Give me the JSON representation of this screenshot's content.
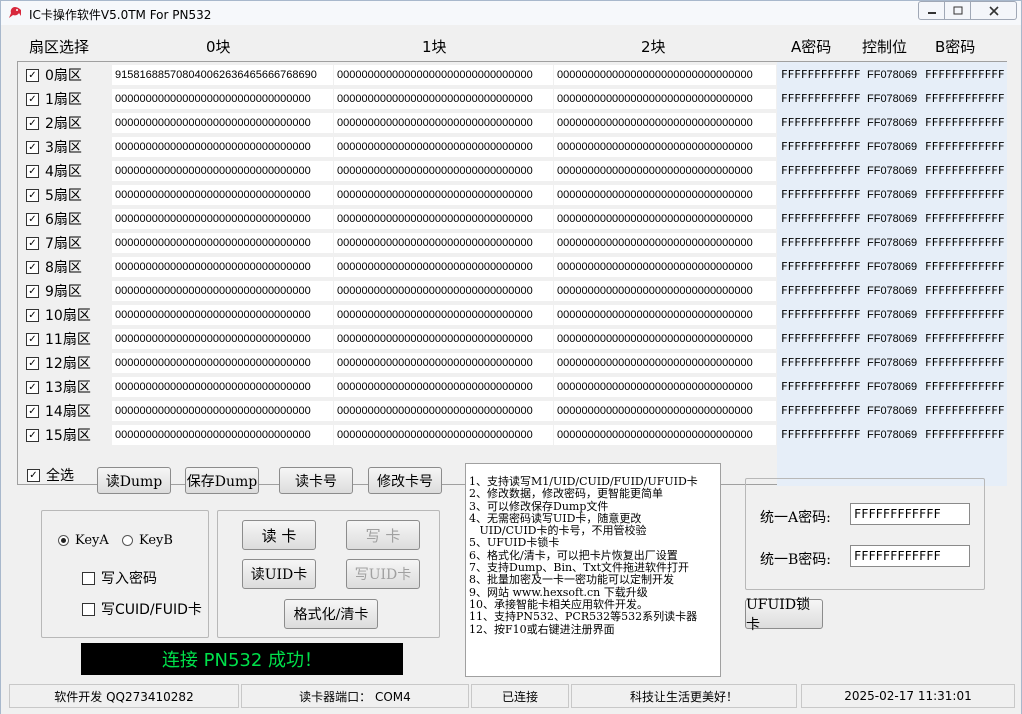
{
  "title": "IC卡操作软件V5.0TM For PN532",
  "columns": {
    "sector": "扇区选择",
    "block0": "0块",
    "block1": "1块",
    "block2": "2块",
    "keyA": "A密码",
    "control": "控制位",
    "keyB": "B密码"
  },
  "sectors": [
    {
      "label": "0扇区",
      "checked": true,
      "b0": "915816885708040062636465666768690",
      "b1": "00000000000000000000000000000000",
      "b2": "00000000000000000000000000000000",
      "keyA": "FFFFFFFFFFFF",
      "ctrl": "FF078069",
      "keyB": "FFFFFFFFFFFF"
    },
    {
      "label": "1扇区",
      "checked": true,
      "b0": "00000000000000000000000000000000",
      "b1": "00000000000000000000000000000000",
      "b2": "00000000000000000000000000000000",
      "keyA": "FFFFFFFFFFFF",
      "ctrl": "FF078069",
      "keyB": "FFFFFFFFFFFF"
    },
    {
      "label": "2扇区",
      "checked": true,
      "b0": "00000000000000000000000000000000",
      "b1": "00000000000000000000000000000000",
      "b2": "00000000000000000000000000000000",
      "keyA": "FFFFFFFFFFFF",
      "ctrl": "FF078069",
      "keyB": "FFFFFFFFFFFF"
    },
    {
      "label": "3扇区",
      "checked": true,
      "b0": "00000000000000000000000000000000",
      "b1": "00000000000000000000000000000000",
      "b2": "00000000000000000000000000000000",
      "keyA": "FFFFFFFFFFFF",
      "ctrl": "FF078069",
      "keyB": "FFFFFFFFFFFF"
    },
    {
      "label": "4扇区",
      "checked": true,
      "b0": "00000000000000000000000000000000",
      "b1": "00000000000000000000000000000000",
      "b2": "00000000000000000000000000000000",
      "keyA": "FFFFFFFFFFFF",
      "ctrl": "FF078069",
      "keyB": "FFFFFFFFFFFF"
    },
    {
      "label": "5扇区",
      "checked": true,
      "b0": "00000000000000000000000000000000",
      "b1": "00000000000000000000000000000000",
      "b2": "00000000000000000000000000000000",
      "keyA": "FFFFFFFFFFFF",
      "ctrl": "FF078069",
      "keyB": "FFFFFFFFFFFF"
    },
    {
      "label": "6扇区",
      "checked": true,
      "b0": "00000000000000000000000000000000",
      "b1": "00000000000000000000000000000000",
      "b2": "00000000000000000000000000000000",
      "keyA": "FFFFFFFFFFFF",
      "ctrl": "FF078069",
      "keyB": "FFFFFFFFFFFF"
    },
    {
      "label": "7扇区",
      "checked": true,
      "b0": "00000000000000000000000000000000",
      "b1": "00000000000000000000000000000000",
      "b2": "00000000000000000000000000000000",
      "keyA": "FFFFFFFFFFFF",
      "ctrl": "FF078069",
      "keyB": "FFFFFFFFFFFF"
    },
    {
      "label": "8扇区",
      "checked": true,
      "b0": "00000000000000000000000000000000",
      "b1": "00000000000000000000000000000000",
      "b2": "00000000000000000000000000000000",
      "keyA": "FFFFFFFFFFFF",
      "ctrl": "FF078069",
      "keyB": "FFFFFFFFFFFF"
    },
    {
      "label": "9扇区",
      "checked": true,
      "b0": "00000000000000000000000000000000",
      "b1": "00000000000000000000000000000000",
      "b2": "00000000000000000000000000000000",
      "keyA": "FFFFFFFFFFFF",
      "ctrl": "FF078069",
      "keyB": "FFFFFFFFFFFF"
    },
    {
      "label": "10扇区",
      "checked": true,
      "b0": "00000000000000000000000000000000",
      "b1": "00000000000000000000000000000000",
      "b2": "00000000000000000000000000000000",
      "keyA": "FFFFFFFFFFFF",
      "ctrl": "FF078069",
      "keyB": "FFFFFFFFFFFF"
    },
    {
      "label": "11扇区",
      "checked": true,
      "b0": "00000000000000000000000000000000",
      "b1": "00000000000000000000000000000000",
      "b2": "00000000000000000000000000000000",
      "keyA": "FFFFFFFFFFFF",
      "ctrl": "FF078069",
      "keyB": "FFFFFFFFFFFF"
    },
    {
      "label": "12扇区",
      "checked": true,
      "b0": "00000000000000000000000000000000",
      "b1": "00000000000000000000000000000000",
      "b2": "00000000000000000000000000000000",
      "keyA": "FFFFFFFFFFFF",
      "ctrl": "FF078069",
      "keyB": "FFFFFFFFFFFF"
    },
    {
      "label": "13扇区",
      "checked": true,
      "b0": "00000000000000000000000000000000",
      "b1": "00000000000000000000000000000000",
      "b2": "00000000000000000000000000000000",
      "keyA": "FFFFFFFFFFFF",
      "ctrl": "FF078069",
      "keyB": "FFFFFFFFFFFF"
    },
    {
      "label": "14扇区",
      "checked": true,
      "b0": "00000000000000000000000000000000",
      "b1": "00000000000000000000000000000000",
      "b2": "00000000000000000000000000000000",
      "keyA": "FFFFFFFFFFFF",
      "ctrl": "FF078069",
      "keyB": "FFFFFFFFFFFF"
    },
    {
      "label": "15扇区",
      "checked": true,
      "b0": "00000000000000000000000000000000",
      "b1": "00000000000000000000000000000000",
      "b2": "00000000000000000000000000000000",
      "keyA": "FFFFFFFFFFFF",
      "ctrl": "FF078069",
      "keyB": "FFFFFFFFFFFF"
    }
  ],
  "select_all": {
    "label": "全选",
    "checked": true
  },
  "file_buttons": {
    "read_dump": "读Dump",
    "save_dump": "保存Dump",
    "read_card_no": "读卡号",
    "modify_card_no": "修改卡号"
  },
  "options": {
    "key_a": "KeyA",
    "key_b": "KeyB",
    "key_a_selected": true,
    "write_key": "写入密码",
    "write_cuid": "写CUID/FUID卡"
  },
  "actions": {
    "read_card": "读 卡",
    "write_card": "写 卡",
    "read_uid": "读UID卡",
    "write_uid": "写UID卡",
    "format": "格式化/清卡"
  },
  "status_message": "连接 PN532 成功！",
  "info_lines": [
    "1、支持读写M1/UID/CUID/FUID/UFUID卡",
    "2、修改数据，修改密码，更智能更简单",
    "3、可以修改保存Dump文件",
    "4、无需密码读写UID卡，随意更改",
    "   UID/CUID卡的卡号，不用管校验",
    "5、UFUID卡锁卡",
    "6、格式化/清卡，可以把卡片恢复出厂设置",
    "7、支持Dump、Bin、Txt文件拖进软件打开",
    "8、批量加密及一卡一密功能可以定制开发",
    "9、网站 www.hexsoft.cn 下载升级",
    "10、承接智能卡相关应用软件开发。",
    "11、支持PN532、PCR532等532系列读卡器",
    "12、按F10或右键进注册界面"
  ],
  "unified_keys": {
    "key_a_label": "统一A密码:",
    "key_a_value": "FFFFFFFFFFFF",
    "key_b_label": "统一B密码:",
    "key_b_value": "FFFFFFFFFFFF"
  },
  "ufuid_lock": "UFUID锁卡",
  "statusbar": {
    "developer": "软件开发   QQ273410282",
    "port": "读卡器端口：  COM4",
    "connection": "已连接",
    "slogan": "科技让生活更美好！",
    "datetime": "2025-02-17 11:31:01"
  },
  "colors": {
    "lcd_background": "#000000",
    "lcd_text": "#00e04a",
    "key_column_bg": "#e6eef8"
  }
}
